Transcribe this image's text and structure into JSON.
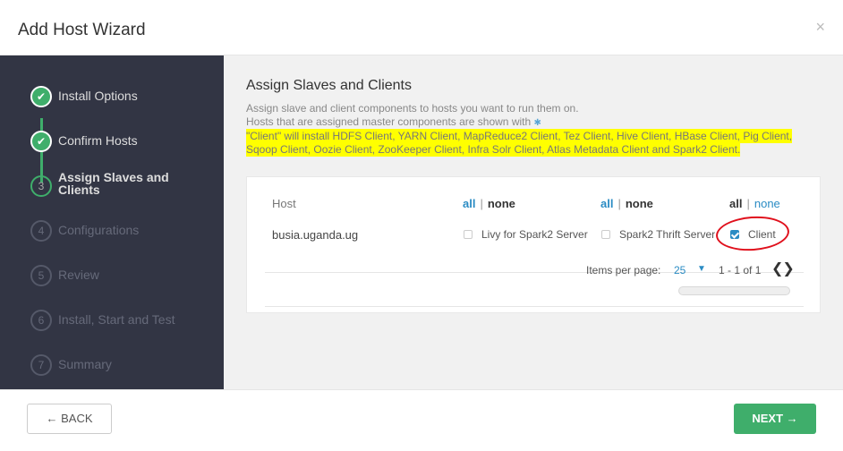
{
  "header": {
    "title": "Add Host Wizard",
    "close": "×"
  },
  "steps": [
    {
      "bullet": "✔",
      "label": "Install Options"
    },
    {
      "bullet": "✔",
      "label": "Confirm Hosts"
    },
    {
      "bullet": "3",
      "label": "Assign Slaves and Clients"
    },
    {
      "bullet": "4",
      "label": "Configurations"
    },
    {
      "bullet": "5",
      "label": "Review"
    },
    {
      "bullet": "6",
      "label": "Install, Start and Test"
    },
    {
      "bullet": "7",
      "label": "Summary"
    }
  ],
  "main": {
    "title": "Assign Slaves and Clients",
    "desc1": "Assign slave and client components to hosts you want to run them on.",
    "desc2": "Hosts that are assigned master components are shown with",
    "star": "✱",
    "highlight": "\"Client\" will install HDFS Client, YARN Client, MapReduce2 Client, Tez Client, Hive Client, HBase Client, Pig Client, Sqoop Client, Oozie Client, ZooKeeper Client, Infra Solr Client, Atlas Metadata Client and Spark2 Client."
  },
  "table": {
    "host_header": "Host",
    "all": "all",
    "sep": "|",
    "none": "none",
    "host": "busia.uganda.ug",
    "components": [
      {
        "label": "Livy for Spark2 Server",
        "checked": false
      },
      {
        "label": "Spark2 Thrift Server",
        "checked": false
      },
      {
        "label": "Client",
        "checked": true
      }
    ]
  },
  "pager": {
    "label": "Items per page:",
    "value": "25",
    "caret": "▼",
    "range": "1 - 1 of 1",
    "arrows": "❮❯"
  },
  "footer": {
    "back": "← BACK",
    "next": "NEXT →"
  }
}
